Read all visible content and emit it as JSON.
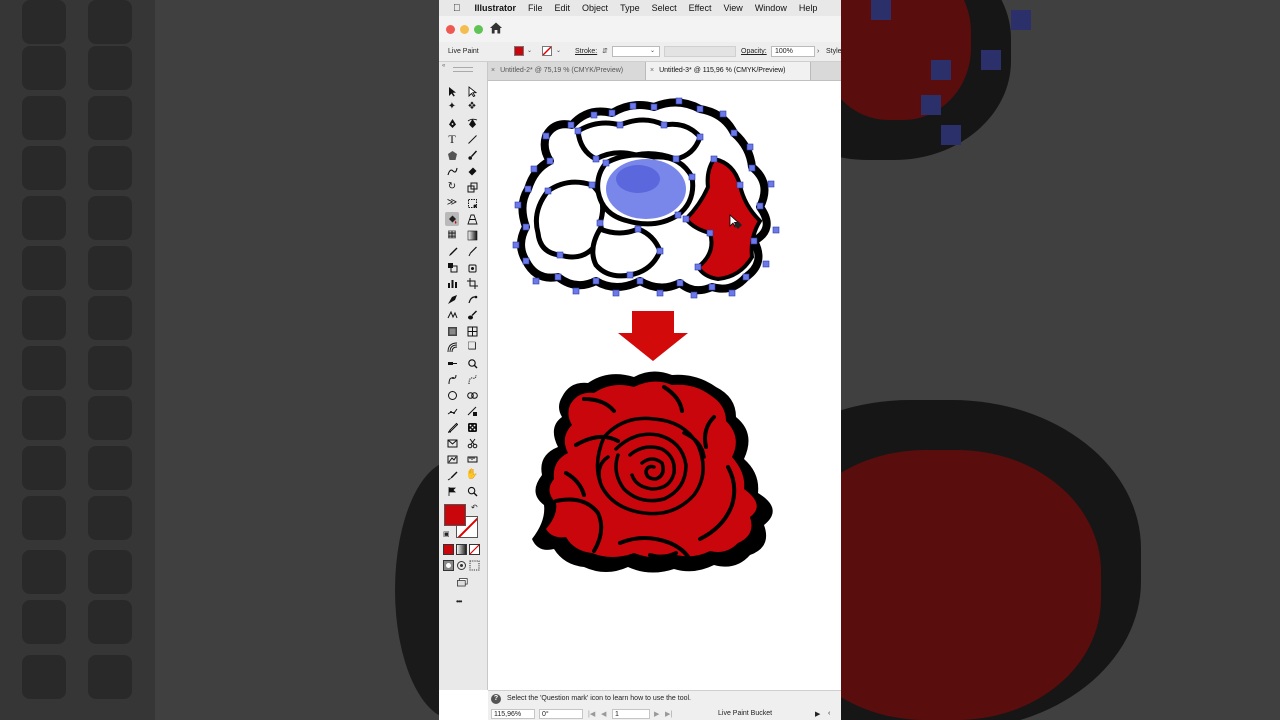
{
  "menubar": {
    "app_name": "Illustrator",
    "items": [
      "File",
      "Edit",
      "Object",
      "Type",
      "Select",
      "Effect",
      "View",
      "Window",
      "Help"
    ]
  },
  "control_bar": {
    "mode_label": "Live Paint",
    "stroke_label": "Stroke:",
    "opacity_label": "Opacity:",
    "opacity_value": "100%",
    "style_label": "Style:",
    "fill_color": "#c8060c"
  },
  "tabs": [
    {
      "close": "×",
      "label": "Untitled-2* @ 75,19 % (CMYK/Preview)",
      "active": false
    },
    {
      "close": "×",
      "label": "Untitled-3* @ 115,96 % (CMYK/Preview)",
      "active": true
    }
  ],
  "toolbar": {
    "collapse": "«",
    "more": "•••",
    "fill_color": "#c8060c",
    "selected_tool": "live-paint-bucket"
  },
  "status_bar": {
    "help": "?",
    "hint": "Select the 'Question mark' icon to learn how to use the tool.",
    "zoom": "115,96%",
    "rotation": "0°",
    "artboard": "1",
    "current_tool": "Live Paint Bucket"
  },
  "colors": {
    "fill_red": "#c8060c",
    "anchor_blue": "#6b7ae8",
    "outline_black": "#000000"
  }
}
